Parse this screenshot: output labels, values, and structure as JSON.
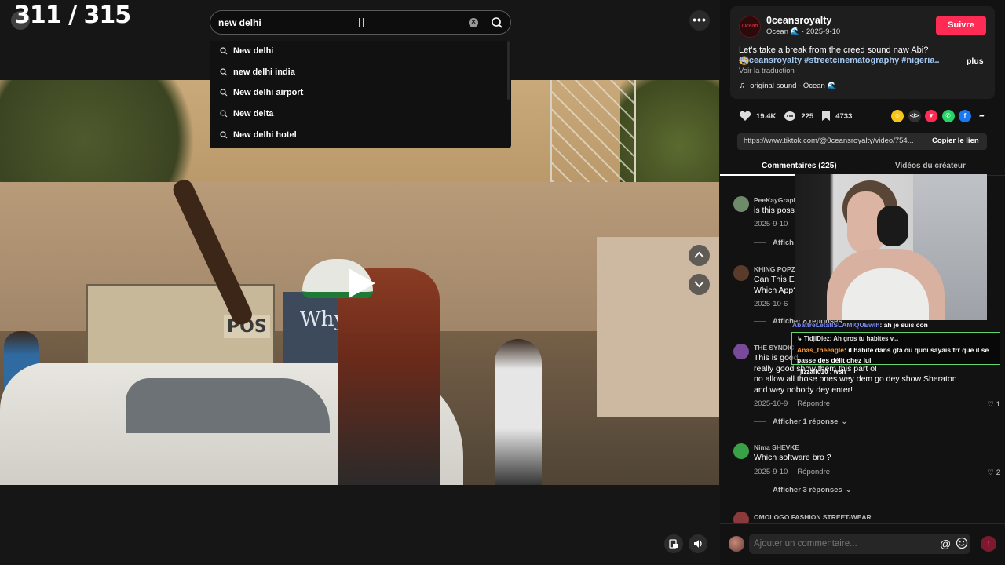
{
  "counter": "311 / 315",
  "search": {
    "value": "new delhi",
    "suggestions": [
      "New delhi",
      "new delhi india",
      "New delhi airport",
      "New delta",
      "New delhi hotel"
    ]
  },
  "more_label": "•••",
  "video": {
    "sign_text": "POS",
    "wall_text": "Why"
  },
  "post": {
    "author": "0ceansroyalty",
    "meta": "Ocean 🌊 · 2025-9-10",
    "follow_label": "Suivre",
    "avatar_text": "Ocean",
    "caption": "Let’s take a break from the creed sound naw Abi? 🤩",
    "hashtags": "#oceansroyalty #streetcinematography #nigeria...",
    "more_label": "plus",
    "translate_label": "Voir la traduction",
    "sound": "original sound - Ocean 🌊"
  },
  "stats": {
    "likes": "19.4K",
    "comments": "225",
    "saves": "4733"
  },
  "share_icons": [
    {
      "name": "emoji-share-icon",
      "color": "#f5c518",
      "glyph": "☺"
    },
    {
      "name": "embed-icon",
      "color": "#333333",
      "glyph": "</>"
    },
    {
      "name": "send-to-friend-icon",
      "color": "#fe2c55",
      "glyph": "▼"
    },
    {
      "name": "whatsapp-icon",
      "color": "#25d366",
      "glyph": "✆"
    },
    {
      "name": "facebook-icon",
      "color": "#1877f2",
      "glyph": "f"
    },
    {
      "name": "share-arrow-icon",
      "color": "#121212",
      "glyph": "➦"
    }
  ],
  "link": {
    "url": "https://www.tiktok.com/@0ceansroyalty/video/754...",
    "copy_label": "Copier le lien"
  },
  "tabs": {
    "comments": "Commentaires (225)",
    "videos": "Vidéos du créateur"
  },
  "comments": [
    {
      "user": "PeeKayGraph",
      "lines": [
        "is this possi"
      ],
      "date": "2025-9-10",
      "reply": "",
      "likes": "",
      "replies": "Affich",
      "avatar_color": "#6f8a6a"
    },
    {
      "user": "KHING POPZ",
      "lines": [
        "Can This Ed",
        "Which App?"
      ],
      "date": "2025-10-6",
      "reply": "",
      "likes": "",
      "replies": "Afficher 8 réponses",
      "avatar_color": "#5a3a2a"
    },
    {
      "user": "THE SYNDIC",
      "lines": [
        "This is good",
        "really good show them this part o!",
        "no allow all those ones wey dem go dey show Sheraton",
        "and wey nobody dey enter!"
      ],
      "date": "2025-10-9",
      "reply": "Répondre",
      "likes": "1",
      "replies": "Afficher 1 réponse",
      "avatar_color": "#7a4a9a"
    },
    {
      "user": "Nima SHEVKE",
      "lines": [
        "Which software bro ?"
      ],
      "date": "2025-9-10",
      "reply": "Répondre",
      "likes": "2",
      "replies": "Afficher 3 réponses",
      "avatar_color": "#3aa048"
    },
    {
      "user": "OMOLOGO FASHION STREET-WEAR",
      "lines": [],
      "date": "",
      "reply": "",
      "likes": "",
      "replies": "",
      "avatar_color": "#8a3a3a"
    }
  ],
  "composer": {
    "placeholder": "Ajouter un commentaire..."
  },
  "stream_chat": {
    "line1_user": "AbattreLetatISLAMIQUEwlh",
    "line1_msg": ": ah je suis con",
    "reply_to": "↳ TidjiDiez:  Ah gros tu habites v...",
    "line2_user": "Anas_theeagle",
    "line2_msg": ": il habite dans gta ou quoi sayais frr que il se passe des délit chez lui",
    "line3": "jizzalfo10 : wsh"
  },
  "colors": {
    "accent": "#fe2c55",
    "hashtag": "#a5c8f0",
    "chat_highlight": "#63d46b"
  }
}
